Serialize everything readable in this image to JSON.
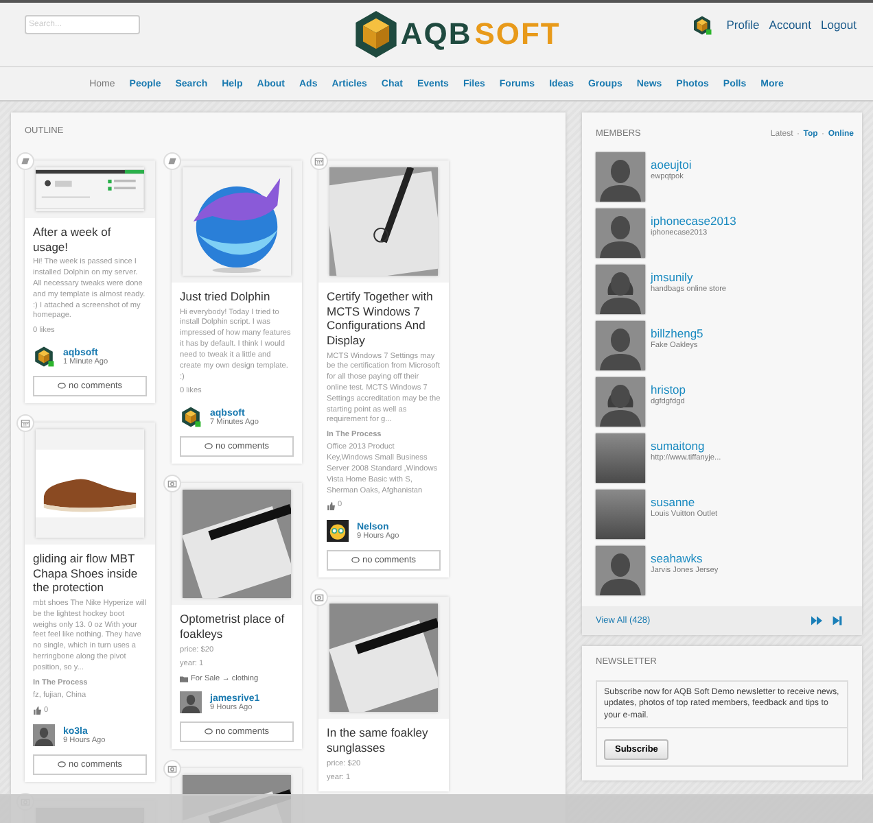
{
  "header": {
    "search": {
      "placeholder": "Search..."
    },
    "logo": {
      "text_a": "AQB",
      "text_b": "SOFT"
    },
    "user_links": [
      "Profile",
      "Account",
      "Logout"
    ]
  },
  "nav": [
    {
      "label": "Home",
      "selected": true
    },
    {
      "label": "People",
      "selected": false
    },
    {
      "label": "Search",
      "selected": false
    },
    {
      "label": "Help",
      "selected": false
    },
    {
      "label": "About",
      "selected": false
    },
    {
      "label": "Ads",
      "selected": false
    },
    {
      "label": "Articles",
      "selected": false
    },
    {
      "label": "Chat",
      "selected": false
    },
    {
      "label": "Events",
      "selected": false
    },
    {
      "label": "Files",
      "selected": false
    },
    {
      "label": "Forums",
      "selected": false
    },
    {
      "label": "Ideas",
      "selected": false
    },
    {
      "label": "Groups",
      "selected": false
    },
    {
      "label": "News",
      "selected": false
    },
    {
      "label": "Photos",
      "selected": false
    },
    {
      "label": "Polls",
      "selected": false
    },
    {
      "label": "More",
      "selected": false
    }
  ],
  "outline": {
    "title": "OUTLINE",
    "columns": [
      [
        {
          "kind": "blog",
          "title": "After a week of usage!",
          "text": "Hi! The week is passed since I installed Dolphin on my server. All necessary tweaks were done and my template is almost ready. :) I attached a screenshot of my homepage.",
          "likes": "0 likes",
          "author": "aqbsoft",
          "time": "1 Minute Ago",
          "comments": "no comments"
        },
        {
          "kind": "event",
          "title": "gliding air flow MBT Chapa Shoes  inside the protection",
          "text": "mbt shoes The Nike Hyperize will be the lightest hockey boot weighs only 13. 0 oz With your feet feel like nothing. They have no single, which in turn uses a herringbone along the pivot position, so y...",
          "status": "In The Process",
          "location": "fz, fujian, China",
          "votes": "0",
          "author": "ko3la",
          "time": "9 Hours Ago",
          "comments": "no comments"
        },
        {
          "kind": "ad"
        }
      ],
      [
        {
          "kind": "blog",
          "title": "Just tried Dolphin",
          "text": "Hi everybody! Today I tried to install Dolphin script. I was impressed of how many features it has by default. I think I would need to tweak it a little and create my own design template. :)",
          "likes": "0 likes",
          "author": "aqbsoft",
          "time": "7 Minutes Ago",
          "comments": "no comments"
        },
        {
          "kind": "ad",
          "title": "Optometrist place of foakleys",
          "price": "price: $20",
          "year": "year: 1",
          "category": "For Sale → clothing",
          "author": "jamesrive1",
          "time": "9 Hours Ago",
          "comments": "no comments"
        },
        {
          "kind": "ad"
        }
      ],
      [
        {
          "kind": "event",
          "title": "Certify Together with MCTS Windows 7 Configurations And Display",
          "text": "MCTS Windows 7 Settings may be the certification from Microsoft for all those paying off their online test. MCTS Windows 7 Settings accreditation may be the starting point as well as requirement for g...",
          "status": "In The Process",
          "location": "Office 2013 Product Key,Windows Small Business Server 2008 Standard ,Windows Vista Home Basic with S, Sherman Oaks, Afghanistan",
          "votes": "0",
          "author": "Nelson",
          "time": "9 Hours Ago",
          "comments": "no comments"
        },
        {
          "kind": "ad",
          "title": "In the same foakley sunglasses",
          "price": "price: $20",
          "year": "year: 1"
        }
      ]
    ]
  },
  "members": {
    "title": "MEMBERS",
    "tabs": [
      {
        "label": "Latest",
        "selected": true
      },
      {
        "label": "Top",
        "selected": false
      },
      {
        "label": "Online",
        "selected": false
      }
    ],
    "items": [
      {
        "name": "aoeujtoi",
        "info": "ewpqtpok"
      },
      {
        "name": "iphonecase2013",
        "info": "iphonecase2013"
      },
      {
        "name": "jmsunily",
        "info": "handbags online store"
      },
      {
        "name": "billzheng5",
        "info": "Fake Oakleys"
      },
      {
        "name": "hristop",
        "info": "dgfdgfdgd"
      },
      {
        "name": "sumaitong",
        "info": "http://www.tiffanyje..."
      },
      {
        "name": "susanne",
        "info": "Louis Vuitton Outlet"
      },
      {
        "name": "seahawks",
        "info": "Jarvis Jones Jersey"
      }
    ],
    "view_all": "View All (428)"
  },
  "newsletter": {
    "title": "NEWSLETTER",
    "text": "Subscribe now for AQB Soft Demo newsletter to receive news, updates, photos of top rated members, feedback and tips to your e-mail.",
    "button": "Subscribe"
  }
}
